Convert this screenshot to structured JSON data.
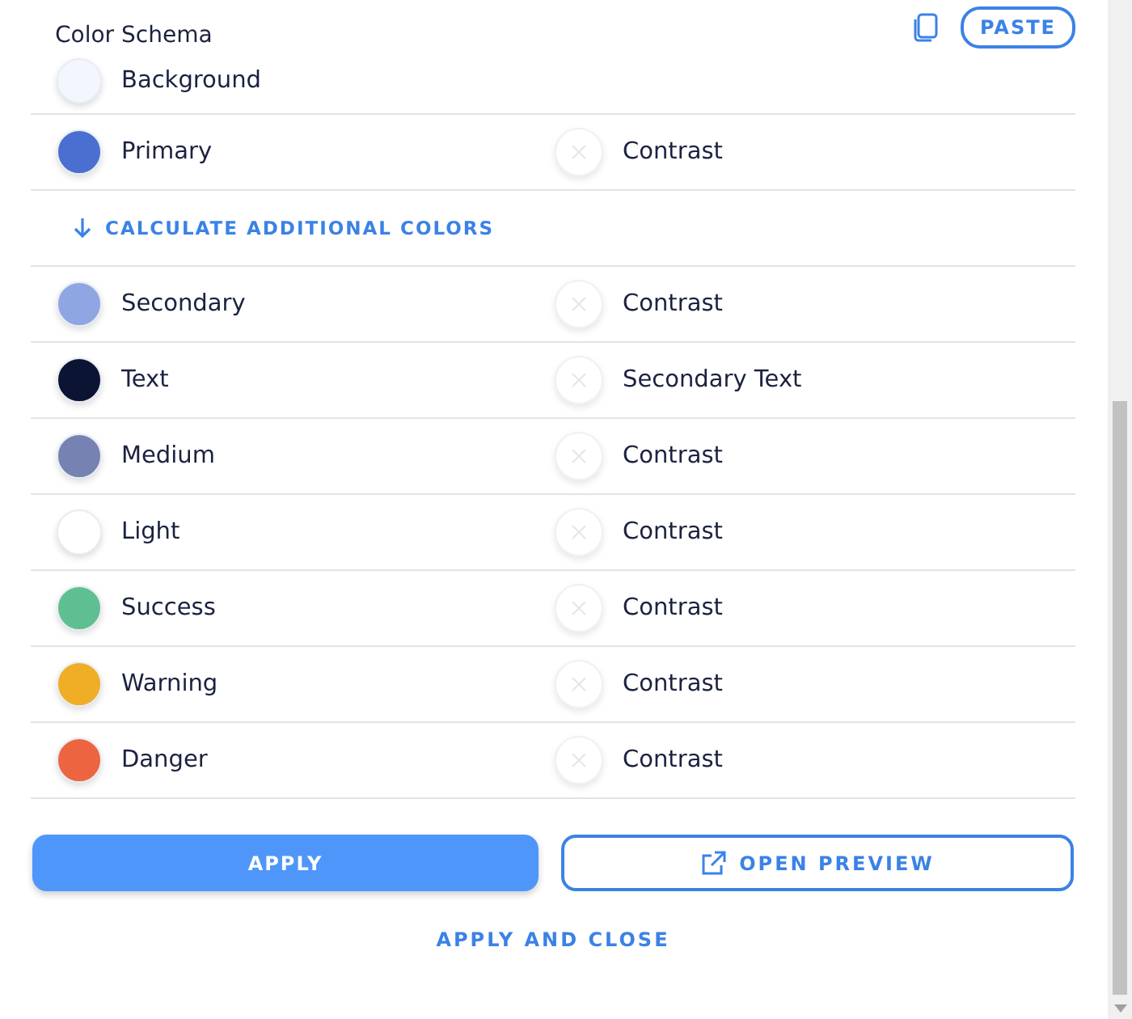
{
  "header": {
    "title": "Color Schema",
    "paste_button": "PASTE"
  },
  "rows": [
    {
      "kind": "color",
      "name": "Background",
      "color": "#f3f6fe"
    },
    {
      "kind": "color",
      "name": "Primary",
      "color": "#4a6fd0",
      "contrast": "Contrast"
    },
    {
      "kind": "action",
      "label": "CALCULATE ADDITIONAL COLORS"
    },
    {
      "kind": "color",
      "name": "Secondary",
      "color": "#8ea6e2",
      "contrast": "Contrast"
    },
    {
      "kind": "color",
      "name": "Text",
      "color": "#0c1433",
      "contrast": "Secondary Text"
    },
    {
      "kind": "color",
      "name": "Medium",
      "color": "#7683b2",
      "contrast": "Contrast"
    },
    {
      "kind": "color",
      "name": "Light",
      "color": "#ffffff",
      "contrast": "Contrast"
    },
    {
      "kind": "color",
      "name": "Success",
      "color": "#5fbf92",
      "contrast": "Contrast"
    },
    {
      "kind": "color",
      "name": "Warning",
      "color": "#f0ad26",
      "contrast": "Contrast"
    },
    {
      "kind": "color",
      "name": "Danger",
      "color": "#ec6540",
      "contrast": "Contrast"
    }
  ],
  "buttons": {
    "apply": "APPLY",
    "preview": "OPEN PREVIEW",
    "apply_close": "APPLY AND CLOSE"
  }
}
